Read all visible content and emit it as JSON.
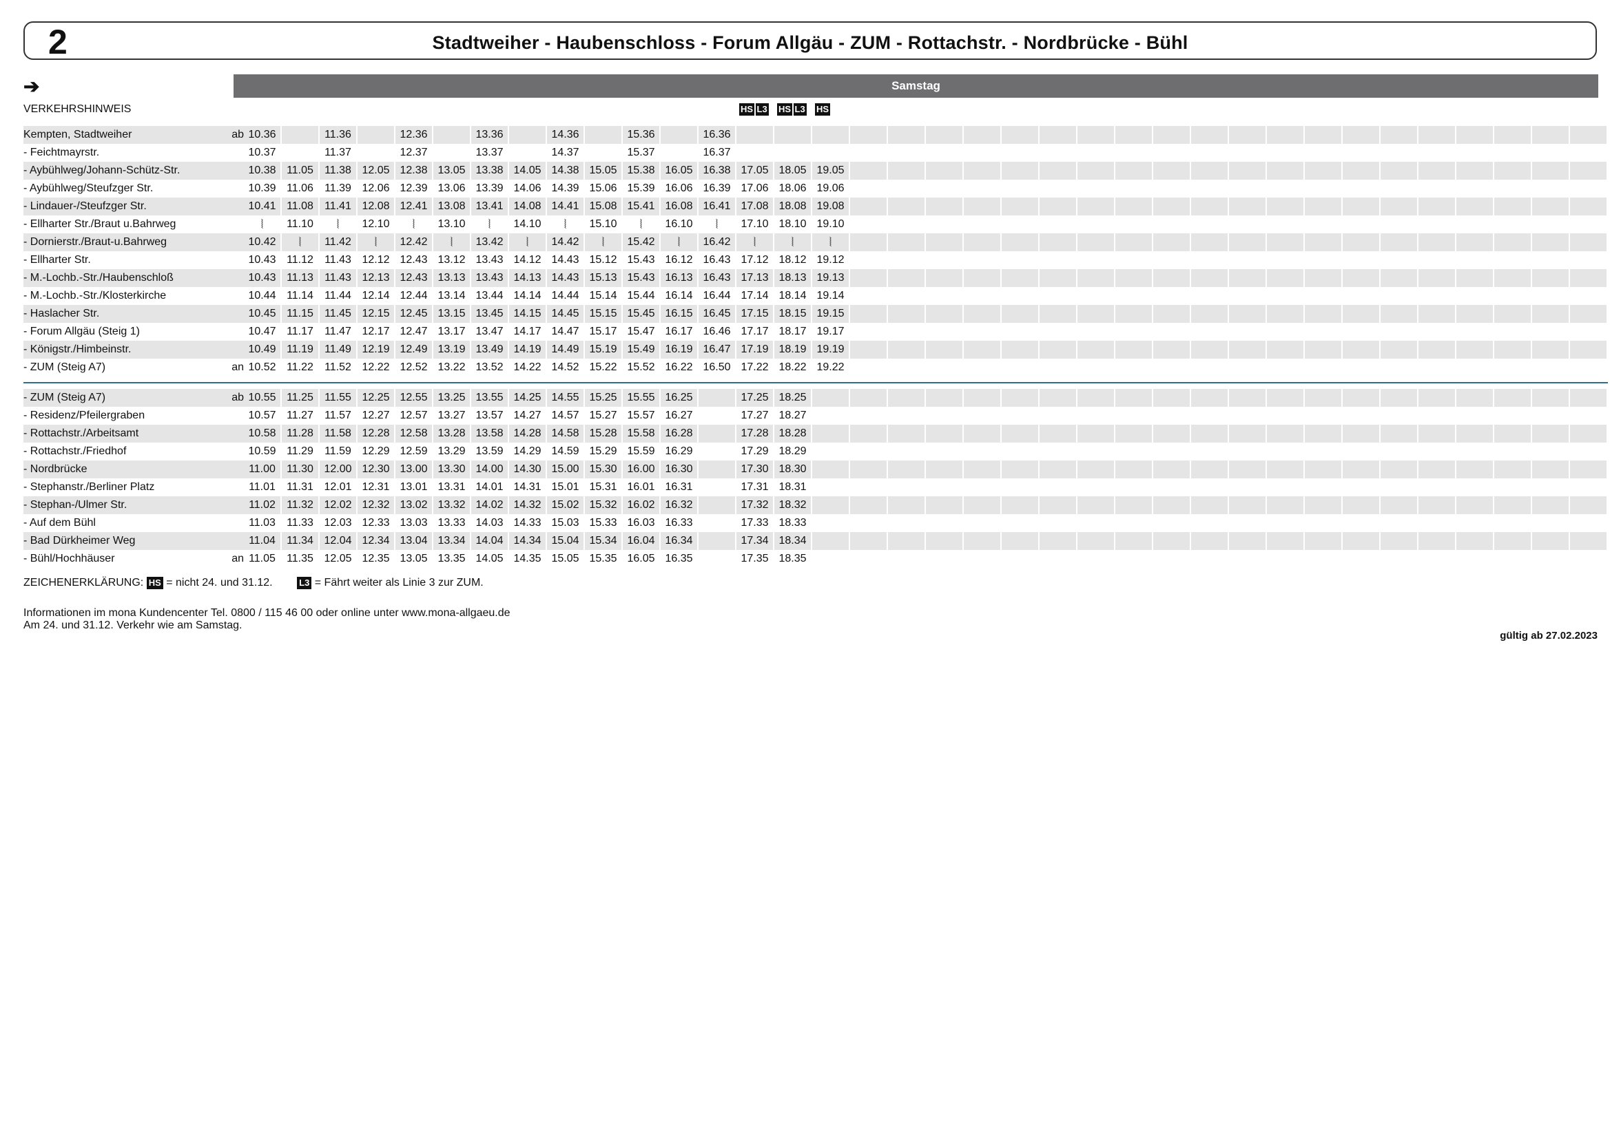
{
  "header": {
    "line_number": "2",
    "route": "Stadtweiher - Haubenschloss - Forum Allgäu - ZUM - Rottachstr. - Nordbrücke - Bühl"
  },
  "direction_symbol": "➔",
  "day_label": "Samstag",
  "notice_label": "VERKEHRSHINWEIS",
  "markers": [
    {
      "col": 13,
      "text": "HS"
    },
    {
      "col": 13.5,
      "text": "L3"
    },
    {
      "col": 14,
      "text": "HS"
    },
    {
      "col": 14.5,
      "text": "L3"
    },
    {
      "col": 15,
      "text": "HS"
    }
  ],
  "wiggle_symbol": "⦚",
  "block1": [
    {
      "stop": "Kempten, Stadtweiher",
      "abn": "ab",
      "times": [
        "10.36",
        "",
        "11.36",
        "",
        "12.36",
        "",
        "13.36",
        "",
        "14.36",
        "",
        "15.36",
        "",
        "16.36",
        "",
        "",
        ""
      ]
    },
    {
      "stop": "- Feichtmayrstr.",
      "abn": "",
      "times": [
        "10.37",
        "",
        "11.37",
        "",
        "12.37",
        "",
        "13.37",
        "",
        "14.37",
        "",
        "15.37",
        "",
        "16.37",
        "",
        "",
        ""
      ]
    },
    {
      "stop": "- Aybühlweg/Johann-Schütz-Str.",
      "abn": "",
      "times": [
        "10.38",
        "11.05",
        "11.38",
        "12.05",
        "12.38",
        "13.05",
        "13.38",
        "14.05",
        "14.38",
        "15.05",
        "15.38",
        "16.05",
        "16.38",
        "17.05",
        "18.05",
        "19.05"
      ]
    },
    {
      "stop": "- Aybühlweg/Steufzger Str.",
      "abn": "",
      "times": [
        "10.39",
        "11.06",
        "11.39",
        "12.06",
        "12.39",
        "13.06",
        "13.39",
        "14.06",
        "14.39",
        "15.06",
        "15.39",
        "16.06",
        "16.39",
        "17.06",
        "18.06",
        "19.06"
      ]
    },
    {
      "stop": "- Lindauer-/Steufzger Str.",
      "abn": "",
      "times": [
        "10.41",
        "11.08",
        "11.41",
        "12.08",
        "12.41",
        "13.08",
        "13.41",
        "14.08",
        "14.41",
        "15.08",
        "15.41",
        "16.08",
        "16.41",
        "17.08",
        "18.08",
        "19.08"
      ]
    },
    {
      "stop": "- Ellharter Str./Braut u.Bahrweg",
      "abn": "",
      "times": [
        "~",
        "11.10",
        "~",
        "12.10",
        "~",
        "13.10",
        "~",
        "14.10",
        "~",
        "15.10",
        "~",
        "16.10",
        "~",
        "17.10",
        "18.10",
        "19.10"
      ]
    },
    {
      "stop": "- Dornierstr./Braut-u.Bahrweg",
      "abn": "",
      "times": [
        "10.42",
        "~",
        "11.42",
        "~",
        "12.42",
        "~",
        "13.42",
        "~",
        "14.42",
        "~",
        "15.42",
        "~",
        "16.42",
        "~",
        "~",
        "~"
      ]
    },
    {
      "stop": "- Ellharter Str.",
      "abn": "",
      "times": [
        "10.43",
        "11.12",
        "11.43",
        "12.12",
        "12.43",
        "13.12",
        "13.43",
        "14.12",
        "14.43",
        "15.12",
        "15.43",
        "16.12",
        "16.43",
        "17.12",
        "18.12",
        "19.12"
      ]
    },
    {
      "stop": "- M.-Lochb.-Str./Haubenschloß",
      "abn": "",
      "times": [
        "10.43",
        "11.13",
        "11.43",
        "12.13",
        "12.43",
        "13.13",
        "13.43",
        "14.13",
        "14.43",
        "15.13",
        "15.43",
        "16.13",
        "16.43",
        "17.13",
        "18.13",
        "19.13"
      ]
    },
    {
      "stop": "- M.-Lochb.-Str./Klosterkirche",
      "abn": "",
      "times": [
        "10.44",
        "11.14",
        "11.44",
        "12.14",
        "12.44",
        "13.14",
        "13.44",
        "14.14",
        "14.44",
        "15.14",
        "15.44",
        "16.14",
        "16.44",
        "17.14",
        "18.14",
        "19.14"
      ]
    },
    {
      "stop": "- Haslacher Str.",
      "abn": "",
      "times": [
        "10.45",
        "11.15",
        "11.45",
        "12.15",
        "12.45",
        "13.15",
        "13.45",
        "14.15",
        "14.45",
        "15.15",
        "15.45",
        "16.15",
        "16.45",
        "17.15",
        "18.15",
        "19.15"
      ]
    },
    {
      "stop": "- Forum Allgäu (Steig 1)",
      "abn": "",
      "times": [
        "10.47",
        "11.17",
        "11.47",
        "12.17",
        "12.47",
        "13.17",
        "13.47",
        "14.17",
        "14.47",
        "15.17",
        "15.47",
        "16.17",
        "16.46",
        "17.17",
        "18.17",
        "19.17"
      ]
    },
    {
      "stop": "- Königstr./Himbeinstr.",
      "abn": "",
      "times": [
        "10.49",
        "11.19",
        "11.49",
        "12.19",
        "12.49",
        "13.19",
        "13.49",
        "14.19",
        "14.49",
        "15.19",
        "15.49",
        "16.19",
        "16.47",
        "17.19",
        "18.19",
        "19.19"
      ]
    },
    {
      "stop": "- ZUM (Steig A7)",
      "abn": "an",
      "times": [
        "10.52",
        "11.22",
        "11.52",
        "12.22",
        "12.52",
        "13.22",
        "13.52",
        "14.22",
        "14.52",
        "15.22",
        "15.52",
        "16.22",
        "16.50",
        "17.22",
        "18.22",
        "19.22"
      ]
    }
  ],
  "block2": [
    {
      "stop": "- ZUM (Steig A7)",
      "abn": "ab",
      "times": [
        "10.55",
        "11.25",
        "11.55",
        "12.25",
        "12.55",
        "13.25",
        "13.55",
        "14.25",
        "14.55",
        "15.25",
        "15.55",
        "16.25",
        "",
        "17.25",
        "18.25",
        ""
      ]
    },
    {
      "stop": "- Residenz/Pfeilergraben",
      "abn": "",
      "times": [
        "10.57",
        "11.27",
        "11.57",
        "12.27",
        "12.57",
        "13.27",
        "13.57",
        "14.27",
        "14.57",
        "15.27",
        "15.57",
        "16.27",
        "",
        "17.27",
        "18.27",
        ""
      ]
    },
    {
      "stop": "- Rottachstr./Arbeitsamt",
      "abn": "",
      "times": [
        "10.58",
        "11.28",
        "11.58",
        "12.28",
        "12.58",
        "13.28",
        "13.58",
        "14.28",
        "14.58",
        "15.28",
        "15.58",
        "16.28",
        "",
        "17.28",
        "18.28",
        ""
      ]
    },
    {
      "stop": "- Rottachstr./Friedhof",
      "abn": "",
      "times": [
        "10.59",
        "11.29",
        "11.59",
        "12.29",
        "12.59",
        "13.29",
        "13.59",
        "14.29",
        "14.59",
        "15.29",
        "15.59",
        "16.29",
        "",
        "17.29",
        "18.29",
        ""
      ]
    },
    {
      "stop": "- Nordbrücke",
      "abn": "",
      "times": [
        "11.00",
        "11.30",
        "12.00",
        "12.30",
        "13.00",
        "13.30",
        "14.00",
        "14.30",
        "15.00",
        "15.30",
        "16.00",
        "16.30",
        "",
        "17.30",
        "18.30",
        ""
      ]
    },
    {
      "stop": "- Stephanstr./Berliner Platz",
      "abn": "",
      "times": [
        "11.01",
        "11.31",
        "12.01",
        "12.31",
        "13.01",
        "13.31",
        "14.01",
        "14.31",
        "15.01",
        "15.31",
        "16.01",
        "16.31",
        "",
        "17.31",
        "18.31",
        ""
      ]
    },
    {
      "stop": "- Stephan-/Ulmer Str.",
      "abn": "",
      "times": [
        "11.02",
        "11.32",
        "12.02",
        "12.32",
        "13.02",
        "13.32",
        "14.02",
        "14.32",
        "15.02",
        "15.32",
        "16.02",
        "16.32",
        "",
        "17.32",
        "18.32",
        ""
      ]
    },
    {
      "stop": "- Auf dem Bühl",
      "abn": "",
      "times": [
        "11.03",
        "11.33",
        "12.03",
        "12.33",
        "13.03",
        "13.33",
        "14.03",
        "14.33",
        "15.03",
        "15.33",
        "16.03",
        "16.33",
        "",
        "17.33",
        "18.33",
        ""
      ]
    },
    {
      "stop": "- Bad Dürkheimer Weg",
      "abn": "",
      "times": [
        "11.04",
        "11.34",
        "12.04",
        "12.34",
        "13.04",
        "13.34",
        "14.04",
        "14.34",
        "15.04",
        "15.34",
        "16.04",
        "16.34",
        "",
        "17.34",
        "18.34",
        ""
      ]
    },
    {
      "stop": "- Bühl/Hochhäuser",
      "abn": "an",
      "times": [
        "11.05",
        "11.35",
        "12.05",
        "12.35",
        "13.05",
        "13.35",
        "14.05",
        "14.35",
        "15.05",
        "15.35",
        "16.05",
        "16.35",
        "",
        "17.35",
        "18.35",
        ""
      ]
    }
  ],
  "total_columns": 36,
  "legend": {
    "prefix": "ZEICHENERKLÄRUNG:",
    "hs_box": "HS",
    "hs_text": "= nicht 24. und 31.12.",
    "l3_box": "L3",
    "l3_text": "= Fährt weiter als Linie 3 zur ZUM."
  },
  "info": {
    "line1": "Informationen im mona Kundencenter Tel. 0800 / 115 46 00 oder online unter www.mona-allgaeu.de",
    "line2": "Am 24. und 31.12. Verkehr wie am Samstag."
  },
  "valid_from": "gültig ab 27.02.2023"
}
